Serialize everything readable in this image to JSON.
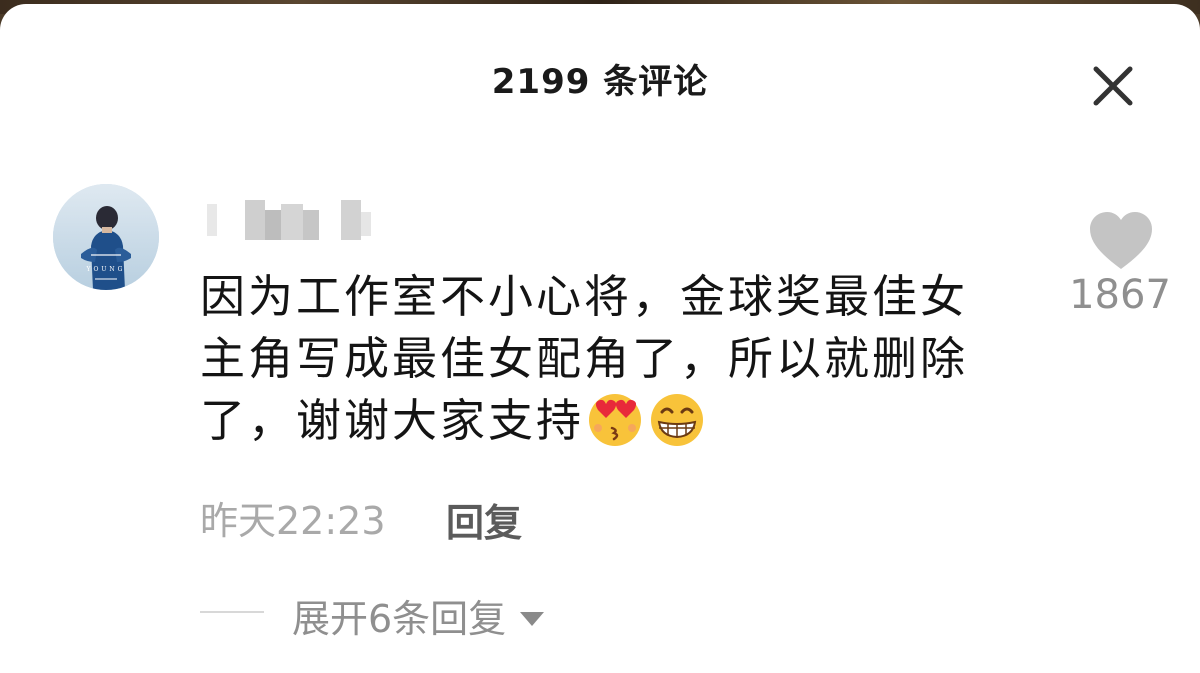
{
  "header": {
    "title": "2199 条评论"
  },
  "comment": {
    "text_line1": "因为工作室不小心将，金球奖最佳女",
    "text_line2": "主角写成最佳女配角了，所以就删除",
    "text_line3": "了，谢谢大家支持",
    "time": "昨天22:23",
    "reply_label": "回复",
    "like_count": "1867",
    "expand_label": "展开6条回复",
    "avatar_caption": "YOUNG"
  },
  "colors": {
    "background": "#ffffff",
    "text_primary": "#141414",
    "text_secondary": "#a9a9a9",
    "like_icon": "#c4c4c4"
  },
  "icons": [
    "close-icon",
    "heart-icon",
    "heart-eyes-kiss-emoji",
    "grin-emoji",
    "triangle-down-icon"
  ]
}
